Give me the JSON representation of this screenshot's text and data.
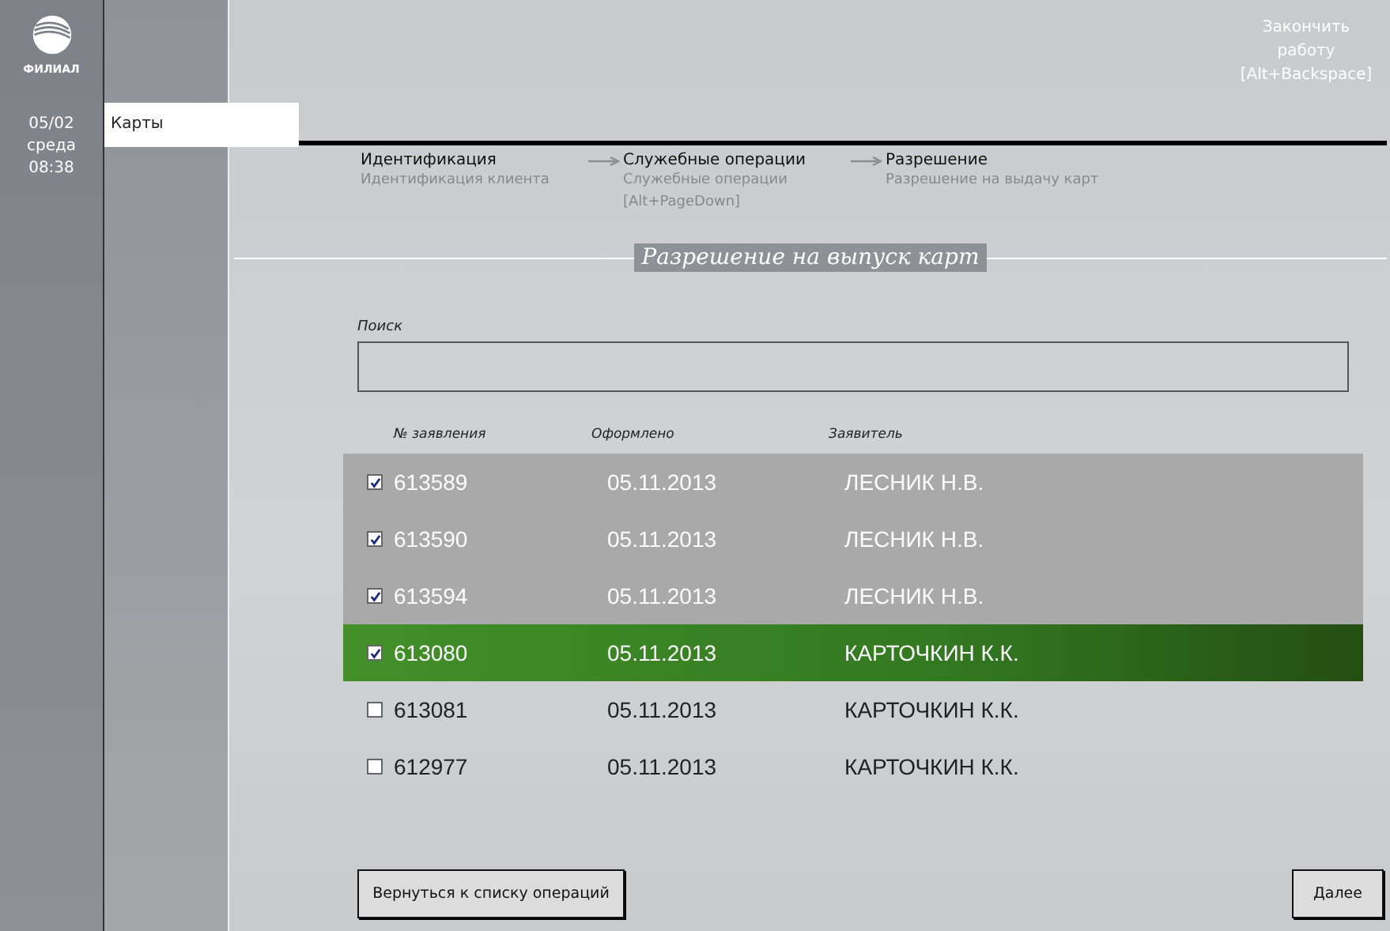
{
  "rail": {
    "logo_text": "ФИЛИАЛ",
    "date": "05/02",
    "weekday": "среда",
    "time": "08:38"
  },
  "nav": {
    "items": [
      {
        "label": "Карты",
        "selected": true
      }
    ]
  },
  "finish": {
    "label": "Закончить работу",
    "shortcut": "[Alt+Backspace]"
  },
  "steps": [
    {
      "title": "Идентификация",
      "subtitle": "Идентификация клиента"
    },
    {
      "title": "Служебные операции",
      "subtitle": "Служебные операции [Alt+PageDown]"
    },
    {
      "title": "Разрешение",
      "subtitle": "Разрешение на выдачу карт"
    }
  ],
  "page_title": "Разрешение на выпуск карт",
  "search": {
    "label": "Поиск"
  },
  "table": {
    "columns": [
      "№ заявления",
      "Оформлено",
      "Заявитель"
    ],
    "rows": [
      {
        "cells": [
          "613589",
          "05.11.2013",
          "ЛЕСНИК Н.В."
        ],
        "checked": true,
        "selected": false
      },
      {
        "cells": [
          "613590",
          "05.11.2013",
          "ЛЕСНИК Н.В."
        ],
        "checked": true,
        "selected": false
      },
      {
        "cells": [
          "613594",
          "05.11.2013",
          "ЛЕСНИК Н.В."
        ],
        "checked": true,
        "selected": false
      },
      {
        "cells": [
          "613080",
          "05.11.2013",
          "КАРТОЧКИН К.К."
        ],
        "checked": true,
        "selected": true
      },
      {
        "cells": [
          "613081",
          "05.11.2013",
          "КАРТОЧКИН К.К."
        ],
        "checked": false,
        "selected": false
      },
      {
        "cells": [
          "612977",
          "05.11.2013",
          "КАРТОЧКИН К.К."
        ],
        "checked": false,
        "selected": false
      }
    ]
  },
  "buttons": {
    "back": "Вернуться к списку операций",
    "next": "Далее"
  }
}
